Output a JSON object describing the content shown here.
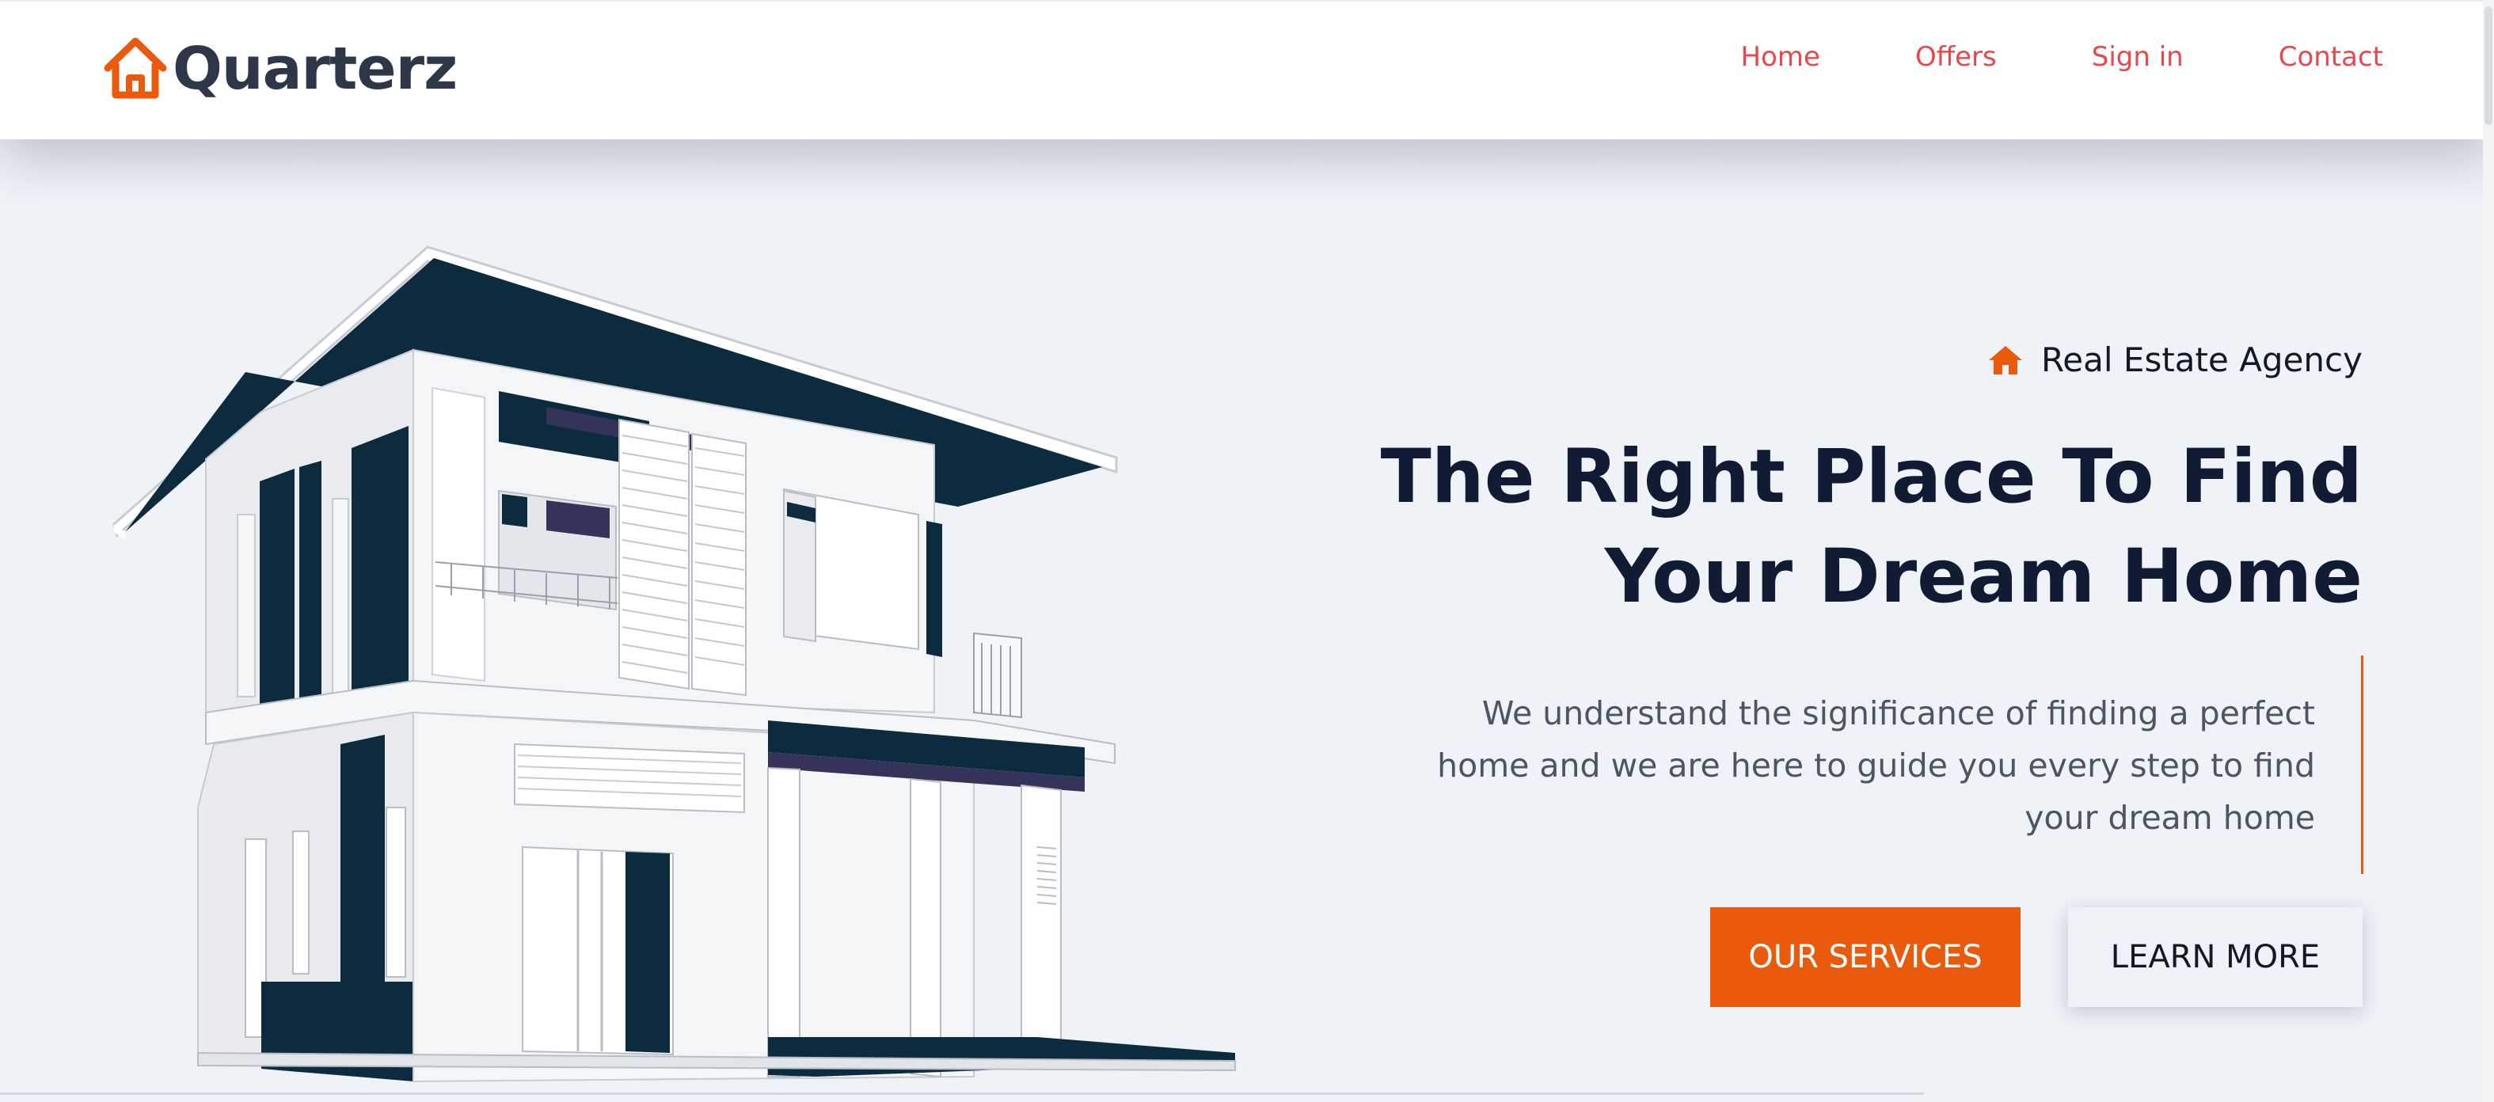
{
  "brand": {
    "name": "Quarterz"
  },
  "nav": {
    "items": [
      {
        "label": "Home"
      },
      {
        "label": "Offers"
      },
      {
        "label": "Sign in"
      },
      {
        "label": "Contact"
      }
    ]
  },
  "hero": {
    "tagline": "Real Estate Agency",
    "headline_line1": "The Right Place To Find",
    "headline_line2": "Your Dream Home",
    "description": "We understand the significance of finding a perfect home and we are here to guide you every step to find your dream home",
    "primary_button": "OUR SERVICES",
    "secondary_button": "LEARN MORE"
  },
  "icons": {
    "logo": "house-outline-icon",
    "tagline": "house-icon"
  },
  "colors": {
    "accent": "#ea5a0c",
    "nav_link": "#e5484d",
    "heading": "#111b33",
    "house_dark": "#0d2b3e",
    "background": "#eff2f7"
  }
}
